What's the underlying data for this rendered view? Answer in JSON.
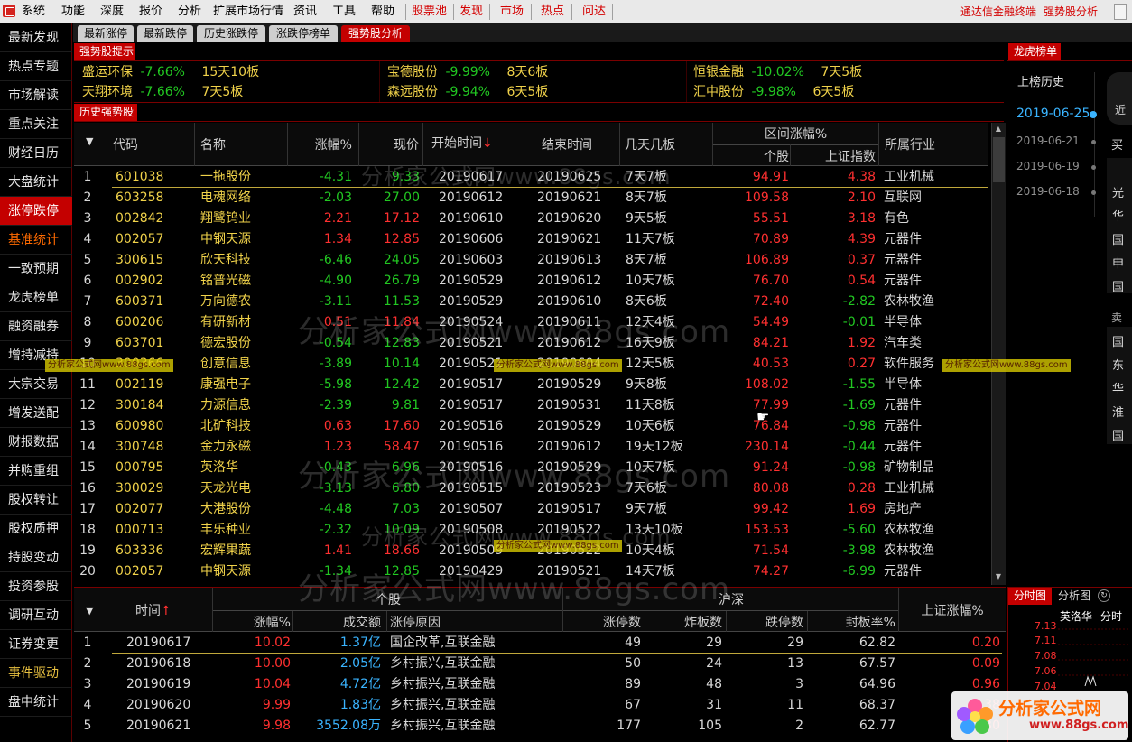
{
  "menu": {
    "items": [
      "系统",
      "功能",
      "深度",
      "报价",
      "分析",
      "扩展市场行情",
      "资讯",
      "工具",
      "帮助"
    ],
    "quick": [
      "股票池",
      "发现",
      "市场",
      "热点",
      "问达"
    ],
    "right_title": "通达信金融终端",
    "right_sub": "强势股分析"
  },
  "sidebar": {
    "items": [
      "最新发现",
      "热点专题",
      "市场解读",
      "重点关注",
      "财经日历",
      "大盘统计",
      "涨停跌停",
      "基准统计",
      "一致预期",
      "龙虎榜单",
      "融资融券",
      "增持减持",
      "大宗交易",
      "增发送配",
      "财报数据",
      "并购重组",
      "股权转让",
      "股权质押",
      "持股变动",
      "投资参股",
      "调研互动",
      "证券变更",
      "事件驱动",
      "盘中统计"
    ]
  },
  "tabs": [
    "最新涨停",
    "最新跌停",
    "历史涨跌停",
    "涨跌停榜单",
    "强势股分析"
  ],
  "strong": {
    "header": "强势股提示",
    "items": [
      {
        "name": "盛运环保",
        "pct": "-7.66%",
        "board": "15天10板"
      },
      {
        "name": "宝德股份",
        "pct": "-9.99%",
        "board": "8天6板"
      },
      {
        "name": "恒银金融",
        "pct": "-10.02%",
        "board": "7天5板"
      },
      {
        "name": "天翔环境",
        "pct": "-7.66%",
        "board": "7天5板"
      },
      {
        "name": "森远股份",
        "pct": "-9.94%",
        "board": "6天5板"
      },
      {
        "name": "汇中股份",
        "pct": "-9.98%",
        "board": "6天5板"
      }
    ]
  },
  "history": {
    "header": "历史强势股",
    "col_code": "代码",
    "col_name": "名称",
    "col_chg": "涨幅%",
    "col_price": "现价",
    "col_start": "开始时间",
    "col_end": "结束时间",
    "col_days": "几天几板",
    "col_range": "区间涨幅%",
    "col_stock": "个股",
    "col_index": "上证指数",
    "col_industry": "所属行业",
    "sort_arrow": "↓",
    "rows": [
      [
        "1",
        "601038",
        "一拖股份",
        "-4.31",
        "9.33",
        "20190617",
        "20190625",
        "7天7板",
        "94.91",
        "4.38",
        "工业机械"
      ],
      [
        "2",
        "603258",
        "电魂网络",
        "-2.03",
        "27.00",
        "20190612",
        "20190621",
        "8天7板",
        "109.58",
        "2.10",
        "互联网"
      ],
      [
        "3",
        "002842",
        "翔鹭钨业",
        "2.21",
        "17.12",
        "20190610",
        "20190620",
        "9天5板",
        "55.51",
        "3.18",
        "有色"
      ],
      [
        "4",
        "002057",
        "中钢天源",
        "1.34",
        "12.85",
        "20190606",
        "20190621",
        "11天7板",
        "70.89",
        "4.39",
        "元器件"
      ],
      [
        "5",
        "300615",
        "欣天科技",
        "-6.46",
        "24.05",
        "20190603",
        "20190613",
        "8天7板",
        "106.89",
        "0.37",
        "元器件"
      ],
      [
        "6",
        "002902",
        "铭普光磁",
        "-4.90",
        "26.79",
        "20190529",
        "20190612",
        "10天7板",
        "76.70",
        "0.54",
        "元器件"
      ],
      [
        "7",
        "600371",
        "万向德农",
        "-3.11",
        "11.53",
        "20190529",
        "20190610",
        "8天6板",
        "72.40",
        "-2.82",
        "农林牧渔"
      ],
      [
        "8",
        "600206",
        "有研新材",
        "0.51",
        "11.84",
        "20190524",
        "20190611",
        "12天4板",
        "54.49",
        "-0.01",
        "半导体"
      ],
      [
        "9",
        "603701",
        "德宏股份",
        "-0.54",
        "12.83",
        "20190521",
        "20190612",
        "16天9板",
        "84.21",
        "1.92",
        "汽车类"
      ],
      [
        "10",
        "300366",
        "创意信息",
        "-3.89",
        "10.14",
        "20190521",
        "20190604",
        "12天5板",
        "40.53",
        "0.27",
        "软件服务"
      ],
      [
        "11",
        "002119",
        "康强电子",
        "-5.98",
        "12.42",
        "20190517",
        "20190529",
        "9天8板",
        "108.02",
        "-1.55",
        "半导体"
      ],
      [
        "12",
        "300184",
        "力源信息",
        "-2.39",
        "9.81",
        "20190517",
        "20190531",
        "11天8板",
        "77.99",
        "-1.69",
        "元器件"
      ],
      [
        "13",
        "600980",
        "北矿科技",
        "0.63",
        "17.60",
        "20190516",
        "20190529",
        "10天6板",
        "76.84",
        "-0.98",
        "元器件"
      ],
      [
        "14",
        "300748",
        "金力永磁",
        "1.23",
        "58.47",
        "20190516",
        "20190612",
        "19天12板",
        "230.14",
        "-0.44",
        "元器件"
      ],
      [
        "15",
        "000795",
        "英洛华",
        "-0.43",
        "6.96",
        "20190516",
        "20190529",
        "10天7板",
        "91.24",
        "-0.98",
        "矿物制品"
      ],
      [
        "16",
        "300029",
        "天龙光电",
        "-3.13",
        "6.80",
        "20190515",
        "20190523",
        "7天6板",
        "80.08",
        "0.28",
        "工业机械"
      ],
      [
        "17",
        "002077",
        "大港股份",
        "-4.48",
        "7.03",
        "20190507",
        "20190517",
        "9天7板",
        "99.42",
        "1.69",
        "房地产"
      ],
      [
        "18",
        "000713",
        "丰乐种业",
        "-2.32",
        "10.09",
        "20190508",
        "20190522",
        "13天10板",
        "153.53",
        "-5.60",
        "农林牧渔"
      ],
      [
        "19",
        "603336",
        "宏辉果蔬",
        "1.41",
        "18.66",
        "20190509",
        "20190522",
        "10天4板",
        "71.54",
        "-3.98",
        "农林牧渔"
      ],
      [
        "20",
        "002057",
        "中钢天源",
        "-1.34",
        "12.85",
        "20190429",
        "20190521",
        "14天7板",
        "74.27",
        "-6.99",
        "元器件"
      ]
    ]
  },
  "lower": {
    "col_time": "时间",
    "time_arrow": "↑",
    "grp_stock": "个股",
    "grp_market": "沪深",
    "col_index": "上证涨幅%",
    "col_chg": "涨幅%",
    "col_amount": "成交额",
    "col_reason": "涨停原因",
    "col_up": "涨停数",
    "col_fried": "炸板数",
    "col_down": "跌停数",
    "col_seal": "封板率%",
    "rows": [
      [
        "1",
        "20190617",
        "10.02",
        "1.37亿",
        "国企改革,互联金融",
        "49",
        "29",
        "29",
        "62.82",
        "0.20"
      ],
      [
        "2",
        "20190618",
        "10.00",
        "2.05亿",
        "乡村振兴,互联金融",
        "50",
        "24",
        "13",
        "67.57",
        "0.09"
      ],
      [
        "3",
        "20190619",
        "10.04",
        "4.72亿",
        "乡村振兴,互联金融",
        "89",
        "48",
        "3",
        "64.96",
        "0.96"
      ],
      [
        "4",
        "20190620",
        "9.99",
        "1.83亿",
        "乡村振兴,互联金融",
        "67",
        "31",
        "11",
        "68.37",
        "2.38"
      ],
      [
        "5",
        "20190621",
        "9.98",
        "3552.08万",
        "乡村振兴,互联金融",
        "177",
        "105",
        "2",
        "62.77",
        "0.30"
      ]
    ]
  },
  "dragon": {
    "header": "龙虎榜单",
    "sub": "上榜历史",
    "dates": [
      "2019-06-25",
      "2019-06-21",
      "2019-06-19",
      "2019-06-18"
    ],
    "side_top": "买",
    "side_bottom": "卖",
    "side_chars_buy": [
      "光",
      "华",
      "国",
      "申",
      "国"
    ],
    "side_chars_sell": [
      "国",
      "东",
      "华",
      "淮",
      "国"
    ],
    "partial": "近"
  },
  "mini": {
    "tabs": [
      "分时图",
      "分析图"
    ],
    "name": "英洛华",
    "label": "分时",
    "prices": [
      "7.13",
      "7.11",
      "7.08",
      "7.06",
      "7.04"
    ]
  },
  "watermark": {
    "big": "分析家公式网www.88gs.com",
    "small": "分析家公式网www.88gs.com",
    "brand": "分析家公式网",
    "url": "www.88gs.com"
  },
  "colors": {
    "accent": "#c40000",
    "positive": "#ff3030",
    "negative": "#22c822",
    "highlight": "#f0d24a"
  }
}
